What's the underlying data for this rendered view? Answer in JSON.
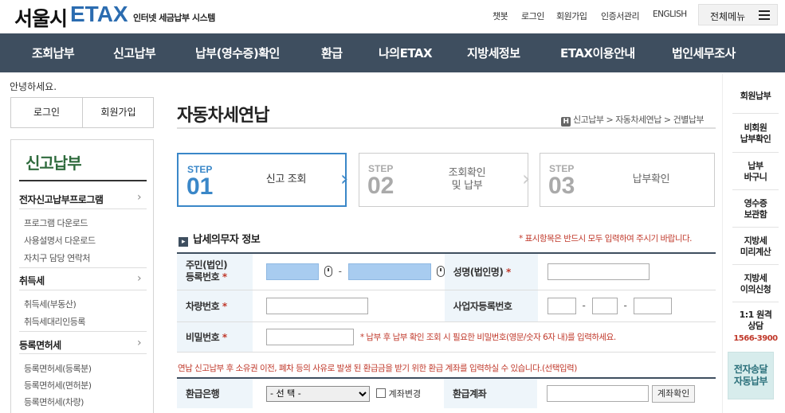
{
  "header": {
    "logo_kor": "서울시",
    "logo_etax": "ETAX",
    "logo_sub": "인터넷 세금납부 시스템",
    "util_links": [
      "챗봇",
      "로그인",
      "회원가입",
      "인증서관리",
      "ENGLISH"
    ],
    "menu_label": "전체메뉴"
  },
  "nav": [
    "조회납부",
    "신고납부",
    "납부(영수증)확인",
    "환급",
    "나의ETAX",
    "지방세정보",
    "ETAX이용안내",
    "법인세무조사"
  ],
  "sidebar": {
    "greeting": "안녕하세요.",
    "login": "로그인",
    "signup": "회원가입",
    "title": "신고납부",
    "categories": [
      {
        "label": "전자신고납부프로그램",
        "subs": [
          "프로그램 다운로드",
          "사용설명서 다운로드",
          "자치구 담당 연락처"
        ]
      },
      {
        "label": "취득세",
        "subs": [
          "취득세(부동산)",
          "취득세대리인등록"
        ]
      },
      {
        "label": "등록면허세",
        "subs": [
          "등록면허세(등록분)",
          "등록면허세(면허분)",
          "등록면허세(차량)"
        ]
      }
    ]
  },
  "main": {
    "title": "자동차세연납",
    "home_icon_label": "H",
    "breadcrumb": "신고납부 > 자동차세연납 > 건별납부",
    "steps": [
      {
        "label": "STEP",
        "num": "01",
        "text": "신고 조회"
      },
      {
        "label": "STEP",
        "num": "02",
        "text": "조회확인\n및 납부"
      },
      {
        "label": "STEP",
        "num": "03",
        "text": "납부확인"
      }
    ],
    "section_icon_label": "▸",
    "section_title": "납세의무자 정보",
    "required_note": "* 표시항목은 반드시 모두 입력하여 주시기 바랍니다.",
    "fields": {
      "rrn_label_1": "주민(법인)",
      "rrn_label_2": "등록번호",
      "name_label": "성명(법인명)",
      "car_label": "차량번호",
      "biz_label": "사업자등록번호",
      "pw_label": "비밀번호",
      "pw_note": "* 납부 후 납부 확인 조회 시 필요한 비밀번호(영문/숫자 6자 내)를 입력하세요.",
      "required_mark": "*",
      "separator": "-"
    },
    "refund_note": "연납 신고납부 후 소유권 이전, 폐차 등의 사유로 발생 된 환급금을 받기 위한 환급 계좌를 입력하실 수 있습니다.(선택입력)",
    "refund": {
      "bank_label": "환급은행",
      "bank_selected": "- 선 택 -",
      "account_change": "계좌변경",
      "account_label": "환급계좌",
      "verify_button": "계좌확인"
    }
  },
  "quick": {
    "items": [
      "회원납부",
      "비회원\n납부확인",
      "납부\n바구니",
      "영수증\n보관함",
      "지방세\n미리계산",
      "지방세\n이의신청"
    ],
    "consult": "1:1 원격\n상담",
    "phone": "1566-3900",
    "car_tax": "전자송달\n자동납부"
  },
  "colors": {
    "nav_bg": "#3e4e5f",
    "accent": "#3a87c8",
    "green": "#2f6b3d",
    "required": "#c0392b"
  }
}
